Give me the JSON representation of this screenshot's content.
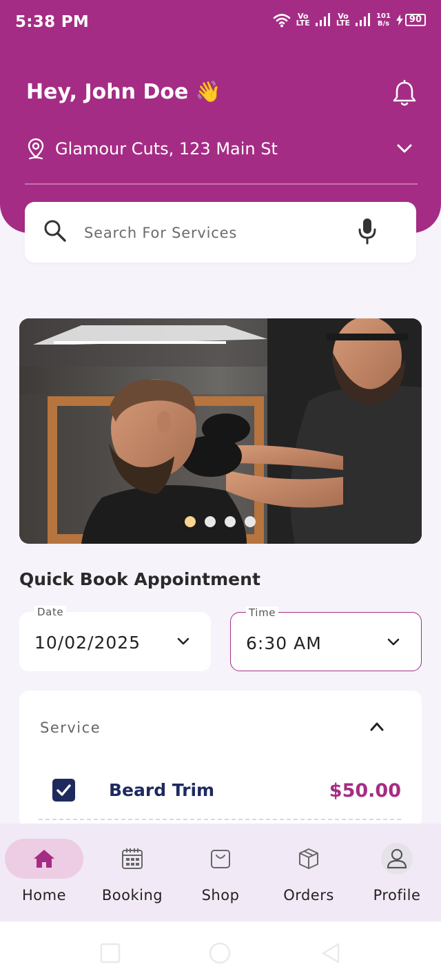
{
  "status_bar": {
    "time": "5:38 PM",
    "signal1": "Vo\nLTE",
    "signal2": "Vo\nLTE",
    "speed_value": "101",
    "speed_unit": "B/s",
    "battery": "90"
  },
  "header": {
    "greeting": "Hey, John Doe 👋",
    "location": "Glamour Cuts, 123 Main St"
  },
  "search": {
    "placeholder": "Search For Services"
  },
  "banner": {
    "slides": 4,
    "active_slide": 1
  },
  "quick_book": {
    "title": "Quick Book Appointment",
    "date_label": "Date",
    "date_value": "10/02/2025",
    "time_label": "Time",
    "time_value": "6:30 AM"
  },
  "service": {
    "label": "Service",
    "items": [
      {
        "name": "Beard Trim",
        "price": "$50.00",
        "checked": true
      }
    ]
  },
  "bottom_nav": {
    "items": [
      {
        "label": "Home",
        "icon": "home-icon",
        "active": true
      },
      {
        "label": "Booking",
        "icon": "calendar-icon",
        "active": false
      },
      {
        "label": "Shop",
        "icon": "shopping-bag-icon",
        "active": false
      },
      {
        "label": "Orders",
        "icon": "box-icon",
        "active": false
      },
      {
        "label": "Profile",
        "icon": "user-icon",
        "active": false
      }
    ]
  },
  "colors": {
    "brand": "#a52c84",
    "navy": "#1e2a5e",
    "background": "#f6f3fb",
    "nav_bg": "#f1eaf6",
    "nav_active": "#eccde4"
  }
}
